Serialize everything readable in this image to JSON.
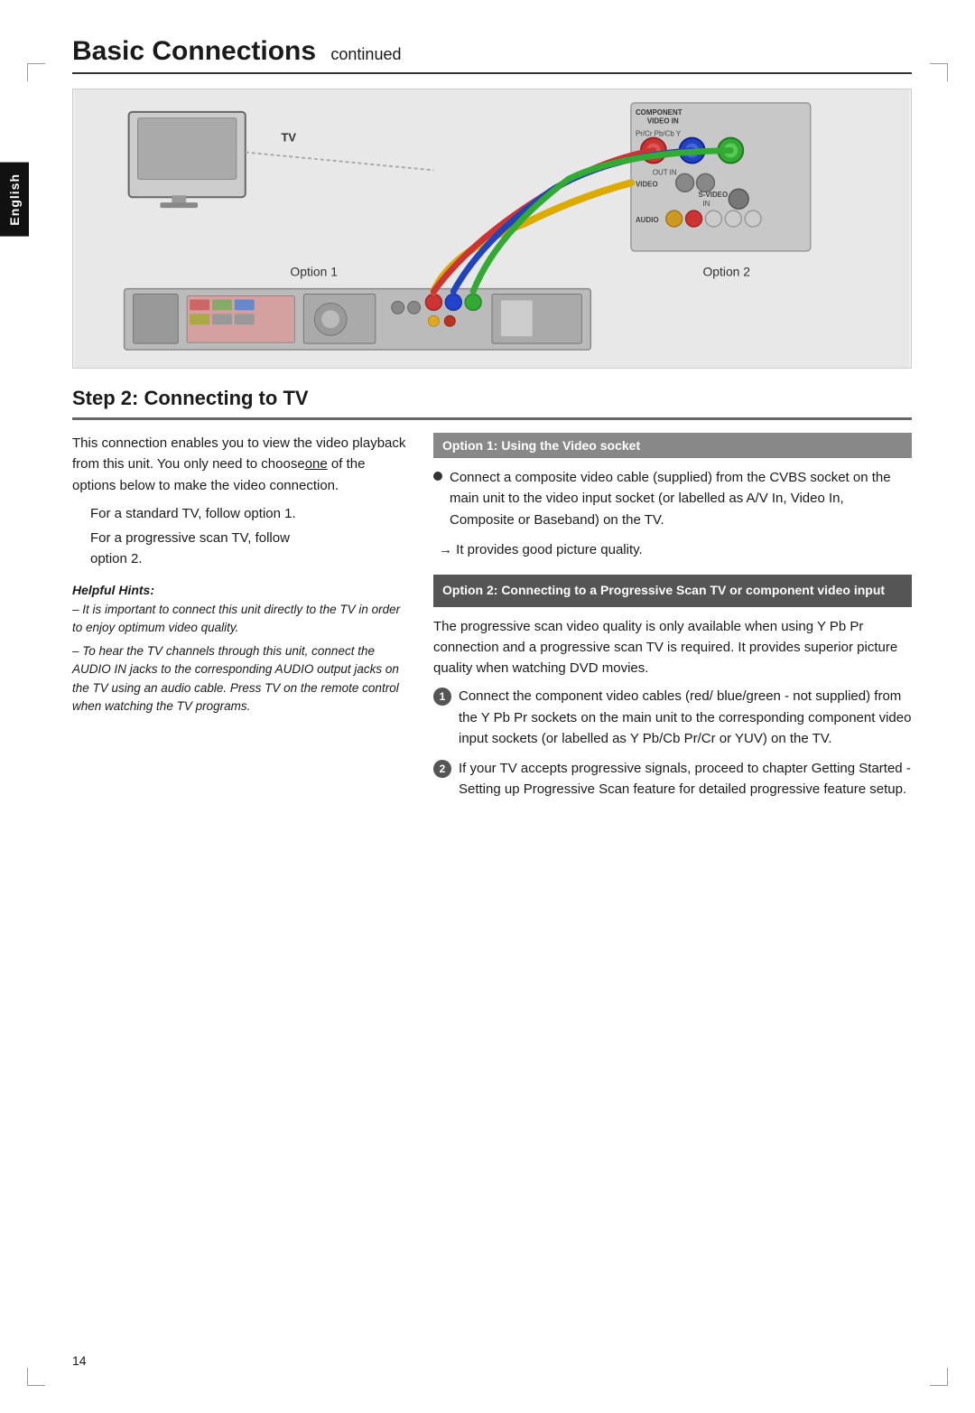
{
  "page": {
    "number": "14",
    "language_tab": "English"
  },
  "title": {
    "main": "Basic Connections",
    "sub": "continued"
  },
  "diagram": {
    "tv_label": "TV",
    "option1_label": "Option 1",
    "option2_label": "Option 2"
  },
  "step2": {
    "heading": "Step 2:  Connecting to TV",
    "intro_p1": "This connection enables you to view the video playback from this unit. You only need to choose",
    "intro_underline": "one",
    "intro_p2": " of the options below to make the video connection.",
    "standard_tv": "For a standard TV, follow option 1.",
    "progressive_tv": "For a progressive scan TV, follow option 2.",
    "helpful_hints_title": "Helpful Hints:",
    "hint1": "– It is important to connect this unit directly to the TV in order to enjoy optimum video quality.",
    "hint2": "– To hear the TV channels through this unit, connect the AUDIO IN jacks to the corresponding AUDIO output jacks on the TV using an audio cable. Press TV on the remote control when watching the TV programs."
  },
  "option1": {
    "header": "Option 1: Using the Video socket",
    "bullet1": "Connect a composite video cable (supplied) from the CVBS socket on the main unit to the video input socket (or labelled as A/V In, Video In, Composite or Baseband) on the TV.",
    "arrow": "It provides good picture quality."
  },
  "option2": {
    "header": "Option 2: Connecting to a Progressive Scan TV or component video input",
    "intro": "The progressive scan video quality is only available when using Y Pb Pr connection and a progressive scan TV is required. It provides superior picture quality when watching DVD movies.",
    "step1": "Connect the component video cables (red/ blue/green - not supplied) from the Y Pb Pr sockets on the main unit to the corresponding component video input sockets (or labelled as Y Pb/Cb Pr/Cr or YUV) on the TV.",
    "step2_text": "If your TV accepts progressive signals, proceed to chapter  Getting Started - Setting up Progressive Scan feature  for detailed progressive feature setup."
  }
}
